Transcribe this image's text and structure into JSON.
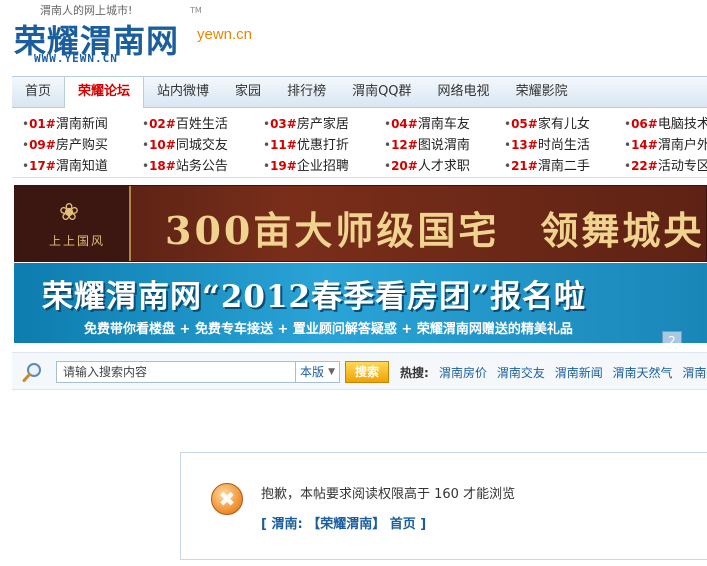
{
  "header": {
    "slogan": "渭南人的网上城市!",
    "logo_text": "荣耀渭南网",
    "logo_tm": "TM",
    "logo_url": "WWW.YEWN.CN",
    "domain": "yewn.cn"
  },
  "nav": {
    "items": [
      {
        "label": "首页"
      },
      {
        "label": "荣耀论坛",
        "active": true
      },
      {
        "label": "站内微博"
      },
      {
        "label": "家园"
      },
      {
        "label": "排行榜"
      },
      {
        "label": "渭南QQ群"
      },
      {
        "label": "网络电视"
      },
      {
        "label": "荣耀影院"
      }
    ]
  },
  "subnav": {
    "columns": [
      [
        {
          "num": "01#",
          "text": "渭南新闻"
        },
        {
          "num": "09#",
          "text": "房产购买"
        },
        {
          "num": "17#",
          "text": "渭南知道"
        }
      ],
      [
        {
          "num": "02#",
          "text": "百姓生活"
        },
        {
          "num": "10#",
          "text": "同城交友"
        },
        {
          "num": "18#",
          "text": "站务公告"
        }
      ],
      [
        {
          "num": "03#",
          "text": "房产家居"
        },
        {
          "num": "11#",
          "text": "优惠打折"
        },
        {
          "num": "19#",
          "text": "企业招聘"
        }
      ],
      [
        {
          "num": "04#",
          "text": "渭南车友"
        },
        {
          "num": "12#",
          "text": "图说渭南"
        },
        {
          "num": "20#",
          "text": "人才求职"
        }
      ],
      [
        {
          "num": "05#",
          "text": "家有儿女"
        },
        {
          "num": "13#",
          "text": "时尚生活"
        },
        {
          "num": "21#",
          "text": "渭南二手"
        }
      ],
      [
        {
          "num": "06#",
          "text": "电脑技术"
        },
        {
          "num": "14#",
          "text": "渭南户外"
        },
        {
          "num": "22#",
          "text": "活动专区"
        }
      ]
    ]
  },
  "banner1": {
    "brand_symbol": "❀",
    "brand_name": "上上国风",
    "headline": "300亩大师级国宅　领舞城央"
  },
  "banner2": {
    "headline": "荣耀渭南网“2012春季看房团”报名啦",
    "tagline": "免费带你看楼盘 + 免费专车接送 + 置业顾问解答疑惑 + 荣耀渭南网赠送的精美礼品",
    "badge": "2"
  },
  "search": {
    "placeholder": "请输入搜索内容",
    "scope": "本版",
    "button": "搜索",
    "hot_label": "热搜:",
    "hot_links": [
      "渭南房价",
      "渭南交友",
      "渭南新闻",
      "渭南天然气",
      "渭南出租"
    ]
  },
  "notice": {
    "message": "抱歉，本帖要求阅读权限高于 160 才能浏览",
    "breadcrumb": "[ 渭南: 【荣耀渭南】 首页 ]",
    "icon_glyph": "✖"
  },
  "colors": {
    "brand_blue": "#1b5e9e",
    "accent_red": "#d40000",
    "domain_orange": "#e58a00"
  }
}
